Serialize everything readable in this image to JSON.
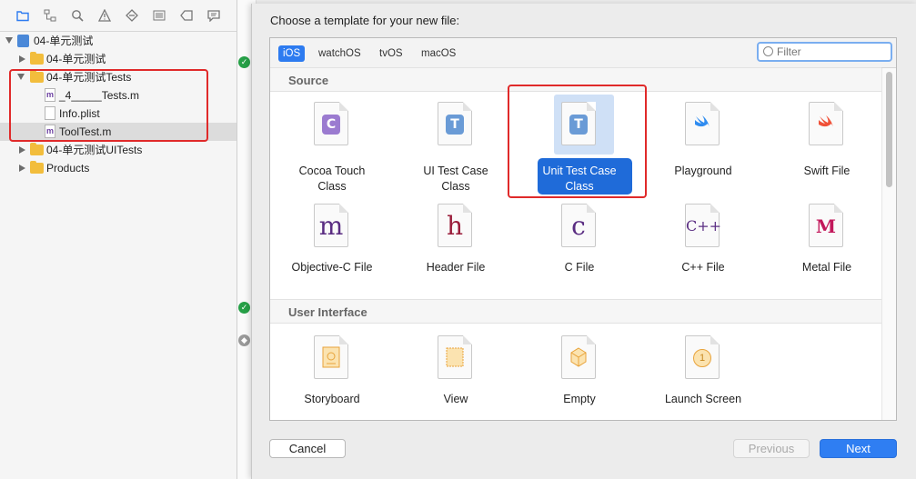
{
  "navigator": {
    "toolbar_icons": [
      "folder-icon",
      "hierarchy-icon",
      "search-icon",
      "warning-icon",
      "diamond-icon",
      "list-icon",
      "tag-icon",
      "comment-icon"
    ],
    "tree": [
      {
        "label": "04-单元测试",
        "kind": "project",
        "expanded": true
      },
      {
        "label": "04-单元测试",
        "kind": "folder",
        "expanded": false
      },
      {
        "label": "04-单元测试Tests",
        "kind": "folder",
        "expanded": true
      },
      {
        "label": "_4_____Tests.m",
        "kind": "file",
        "icon_letter": "m"
      },
      {
        "label": "Info.plist",
        "kind": "file",
        "icon_letter": ""
      },
      {
        "label": "ToolTest.m",
        "kind": "file",
        "icon_letter": "m"
      },
      {
        "label": "04-单元测试UITests",
        "kind": "folder",
        "expanded": false
      },
      {
        "label": "Products",
        "kind": "folder",
        "expanded": false
      }
    ]
  },
  "sheet": {
    "title": "Choose a template for your new file:",
    "tabs": [
      "iOS",
      "watchOS",
      "tvOS",
      "macOS"
    ],
    "active_tab": "iOS",
    "filter_placeholder": "Filter",
    "sections": [
      {
        "name": "Source",
        "templates": [
          {
            "line1": "Cocoa Touch",
            "line2": "Class",
            "icon": "cocoa-touch-class-icon",
            "glyph": "C",
            "color": "#9b7bd0"
          },
          {
            "line1": "UI Test Case",
            "line2": "Class",
            "icon": "ui-test-case-icon",
            "glyph": "T",
            "color": "#6a9bd6"
          },
          {
            "line1": "Unit Test Case",
            "line2": "Class",
            "icon": "unit-test-case-icon",
            "glyph": "T",
            "color": "#6a9bd6",
            "selected": true
          },
          {
            "line1": "Playground",
            "line2": "",
            "icon": "swift-playground-icon",
            "glyph": "",
            "color": "#2f8cf0"
          },
          {
            "line1": "Swift File",
            "line2": "",
            "icon": "swift-file-icon",
            "glyph": "",
            "color": "#f05138"
          },
          {
            "line1": "Objective-C File",
            "line2": "",
            "icon": "objc-file-icon",
            "glyph": "m",
            "color": "#5a2d82"
          },
          {
            "line1": "Header File",
            "line2": "",
            "icon": "header-file-icon",
            "glyph": "h",
            "color": "#9a1d3b"
          },
          {
            "line1": "C File",
            "line2": "",
            "icon": "c-file-icon",
            "glyph": "c",
            "color": "#5a2d82"
          },
          {
            "line1": "C++ File",
            "line2": "",
            "icon": "cpp-file-icon",
            "glyph": "C++",
            "color": "#5a2d82"
          },
          {
            "line1": "Metal File",
            "line2": "",
            "icon": "metal-file-icon",
            "glyph": "M",
            "color": "#c2185b"
          }
        ]
      },
      {
        "name": "User Interface",
        "templates": [
          {
            "line1": "Storyboard",
            "line2": "",
            "icon": "storyboard-icon",
            "glyph": "",
            "color": "#e8a33b"
          },
          {
            "line1": "View",
            "line2": "",
            "icon": "view-icon",
            "glyph": "",
            "color": "#e8a33b"
          },
          {
            "line1": "Empty",
            "line2": "",
            "icon": "empty-icon",
            "glyph": "",
            "color": "#e8a33b"
          },
          {
            "line1": "Launch Screen",
            "line2": "",
            "icon": "launch-screen-icon",
            "glyph": "1",
            "color": "#e8a33b"
          }
        ]
      }
    ],
    "buttons": {
      "cancel": "Cancel",
      "previous": "Previous",
      "next": "Next"
    }
  },
  "colors": {
    "accent": "#2d7bf0",
    "highlight": "#e02a2a",
    "selection": "#1f6bd9"
  }
}
